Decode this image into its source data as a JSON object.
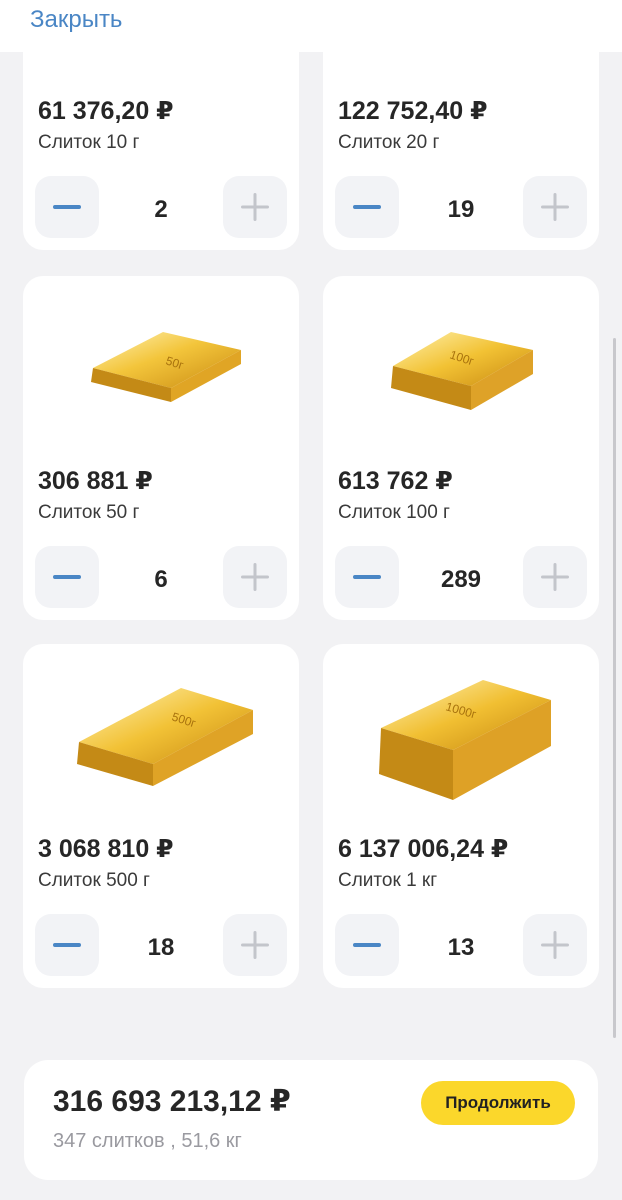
{
  "header": {
    "close_label": "Закрыть"
  },
  "colors": {
    "accent_blue": "#4a86c5",
    "button_bg": "#f2f3f6",
    "cta_yellow": "#fbd72b",
    "gold": "#e2b02c"
  },
  "products": [
    {
      "price": "61 376,20 ₽",
      "name": "Слиток 10 г",
      "quantity": "2"
    },
    {
      "price": "122 752,40 ₽",
      "name": "Слиток 20 г",
      "quantity": "19"
    },
    {
      "price": "306 881 ₽",
      "name": "Слиток 50 г",
      "quantity": "6",
      "bar_label": "50г"
    },
    {
      "price": "613 762 ₽",
      "name": "Слиток 100 г",
      "quantity": "289",
      "bar_label": "100г"
    },
    {
      "price": "3 068 810 ₽",
      "name": "Слиток 500 г",
      "quantity": "18",
      "bar_label": "500г"
    },
    {
      "price": "6 137 006,24 ₽",
      "name": "Слиток 1 кг",
      "quantity": "13",
      "bar_label": "1000г"
    }
  ],
  "summary": {
    "total": "316 693 213,12 ₽",
    "details": "347 слитков , 51,6 кг",
    "continue_label": "Продолжить"
  },
  "icons": {
    "minus": "minus-icon",
    "plus": "plus-icon"
  }
}
